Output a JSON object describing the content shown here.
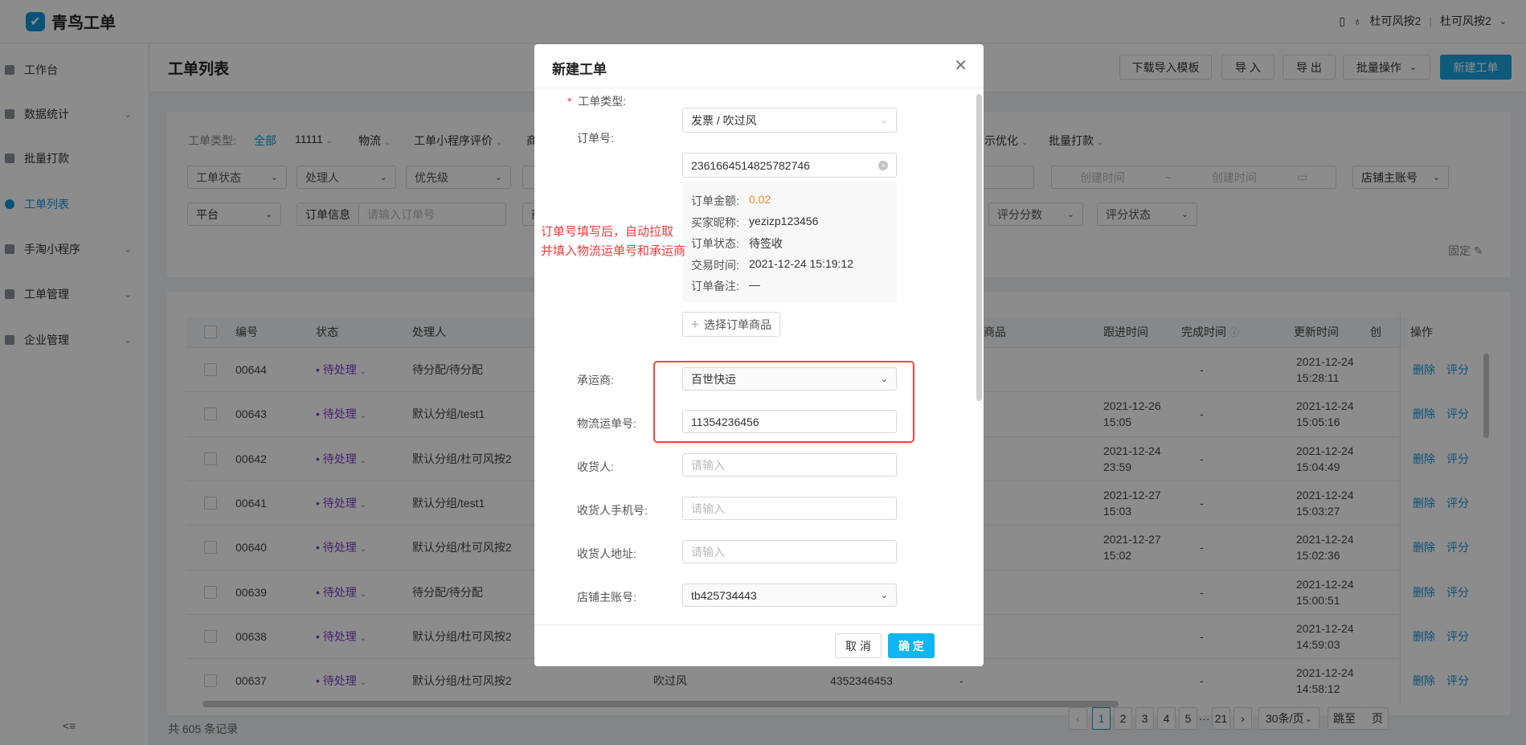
{
  "app": {
    "name": "青鸟工单",
    "user": "杜可风按2",
    "org": "杜可风按2"
  },
  "sidebar": {
    "items": [
      {
        "label": "工作台",
        "chevron": false
      },
      {
        "label": "数据统计",
        "chevron": true
      },
      {
        "label": "批量打款",
        "chevron": false
      },
      {
        "label": "工单列表",
        "chevron": false,
        "active": true
      },
      {
        "label": "手淘小程序",
        "chevron": true
      },
      {
        "label": "工单管理",
        "chevron": true
      },
      {
        "label": "企业管理",
        "chevron": true
      }
    ],
    "collapse_icon": "<≡"
  },
  "page": {
    "title": "工单列表",
    "buttons": {
      "download_template": "下载导入模板",
      "import": "导 入",
      "export": "导 出",
      "batch": "批量操作",
      "create": "新建工单"
    }
  },
  "filters": {
    "type_label": "工单类型:",
    "types": [
      "全部",
      "11111",
      "物流",
      "工单小程序评价",
      "商",
      "示优化",
      "批量打款"
    ],
    "row1": {
      "status": "工单状态",
      "handler": "处理人",
      "priority": "优先级",
      "created_from": "创建时间",
      "tilde": "~",
      "created_to": "创建时间",
      "shop": "店铺主账号"
    },
    "row2": {
      "platform": "平台",
      "order_info": "订单信息",
      "order_placeholder": "请输入订单号",
      "partial": "商",
      "score": "评分分数",
      "score_status": "评分状态"
    },
    "pin": "固定"
  },
  "table": {
    "headers": {
      "id": "编号",
      "status": "状态",
      "handler": "处理人",
      "goods": "商品",
      "followup": "跟进时间",
      "finish": "完成时间",
      "updated": "更新时间",
      "created": "创",
      "actions": "操作"
    },
    "actions": {
      "delete": "删除",
      "rate": "评分"
    },
    "rows": [
      {
        "id": "00644",
        "status": "待处理",
        "handler": "待分配/待分配",
        "followup_date": "",
        "followup_time": "",
        "finish": "-",
        "updated_date": "2021-12-24",
        "updated_time": "15:28:11"
      },
      {
        "id": "00643",
        "status": "待处理",
        "handler": "默认分组/test1",
        "followup_date": "2021-12-26",
        "followup_time": "15:05",
        "finish": "-",
        "updated_date": "2021-12-24",
        "updated_time": "15:05:16"
      },
      {
        "id": "00642",
        "status": "待处理",
        "handler": "默认分组/杜可风按2",
        "followup_date": "2021-12-24",
        "followup_time": "23:59",
        "finish": "-",
        "updated_date": "2021-12-24",
        "updated_time": "15:04:49"
      },
      {
        "id": "00641",
        "status": "待处理",
        "handler": "默认分组/test1",
        "followup_date": "2021-12-27",
        "followup_time": "15:03",
        "finish": "-",
        "updated_date": "2021-12-24",
        "updated_time": "15:03:27"
      },
      {
        "id": "00640",
        "status": "待处理",
        "handler": "默认分组/杜可风按2",
        "followup_date": "2021-12-27",
        "followup_time": "15:02",
        "finish": "-",
        "updated_date": "2021-12-24",
        "updated_time": "15:02:36"
      },
      {
        "id": "00639",
        "status": "待处理",
        "handler": "待分配/待分配",
        "followup_date": "",
        "followup_time": "",
        "finish": "-",
        "updated_date": "2021-12-24",
        "updated_time": "15:00:51"
      },
      {
        "id": "00638",
        "status": "待处理",
        "handler": "默认分组/杜可风按2",
        "followup_date": "",
        "followup_time": "",
        "finish": "-",
        "updated_date": "2021-12-24",
        "updated_time": "14:59:03"
      },
      {
        "id": "00637",
        "status": "待处理",
        "handler": "默认分组/杜可风按2",
        "type": "吹过风",
        "order_no": "4352346453",
        "extra": "-",
        "followup_date": "",
        "followup_time": "",
        "finish": "-",
        "updated_date": "2021-12-24",
        "updated_time": "14:58:12"
      }
    ]
  },
  "footer": {
    "total": "共 605 条记录",
    "pages": [
      "1",
      "2",
      "3",
      "4",
      "5",
      "···",
      "21"
    ],
    "current_page": "1",
    "page_size": "30条/页",
    "jump": "跳至",
    "page_unit": "页"
  },
  "modal": {
    "title": "新建工单",
    "required_mark": "*",
    "fields": {
      "type": {
        "label": "工单类型:",
        "value": "发票 / 吹过风"
      },
      "order_no": {
        "label": "订单号:",
        "value": "2361664514825782746"
      },
      "carrier": {
        "label": "承运商:",
        "value": "百世快运"
      },
      "tracking": {
        "label": "物流运单号:",
        "value": "11354236456"
      },
      "receiver": {
        "label": "收货人:",
        "placeholder": "请输入"
      },
      "phone": {
        "label": "收货人手机号:",
        "placeholder": "请输入"
      },
      "address": {
        "label": "收货人地址:",
        "placeholder": "请输入"
      },
      "shop": {
        "label": "店铺主账号:",
        "value": "tb425734443"
      }
    },
    "order_info": [
      {
        "k": "订单金额:",
        "v": "0.02"
      },
      {
        "k": "买家昵称:",
        "v": "yezizp123456"
      },
      {
        "k": "订单状态:",
        "v": "待签收"
      },
      {
        "k": "交易时间:",
        "v": "2021-12-24 15:19:12"
      },
      {
        "k": "订单备注:",
        "v": "—"
      }
    ],
    "select_goods": "选择订单商品",
    "annotation": [
      "订单号填写后，自动拉取",
      "并填入物流运单号和承运商"
    ],
    "cancel": "取 消",
    "ok": "确 定"
  },
  "colors": {
    "primary": "#1296db",
    "modal_ok": "#0fb6f0",
    "status": "#7b3fc8",
    "amount": "#f5862a",
    "annotation": "#f0393a"
  }
}
